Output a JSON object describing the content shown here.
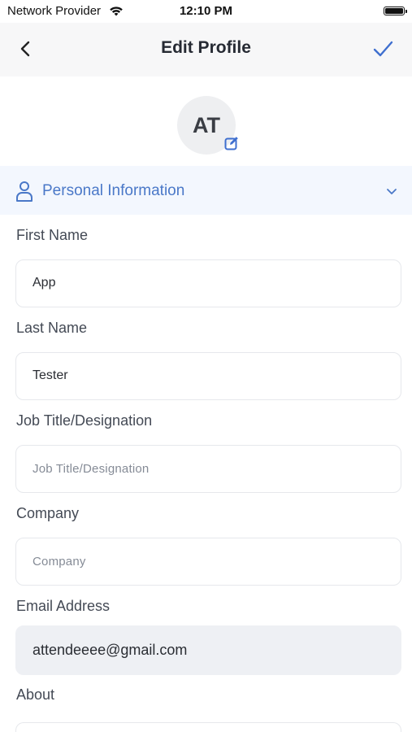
{
  "status_bar": {
    "carrier": "Network Provider",
    "time": "12:10 PM"
  },
  "nav": {
    "title": "Edit Profile"
  },
  "avatar": {
    "initials": "AT"
  },
  "section": {
    "label": "Personal Information"
  },
  "fields": [
    {
      "label": "First Name",
      "value": "App",
      "placeholder": ""
    },
    {
      "label": "Last Name",
      "value": "Tester",
      "placeholder": ""
    },
    {
      "label": "Job Title/Designation",
      "value": "",
      "placeholder": "Job Title/Designation"
    },
    {
      "label": "Company",
      "value": "",
      "placeholder": "Company"
    },
    {
      "label": "Email Address",
      "value": "attendeeee@gmail.com",
      "placeholder": ""
    },
    {
      "label": "About",
      "value": "",
      "placeholder": ""
    }
  ],
  "colors": {
    "accent": "#4a78c8",
    "nav_bg": "#f7f7f8",
    "section_bg": "#f3f7fe"
  }
}
